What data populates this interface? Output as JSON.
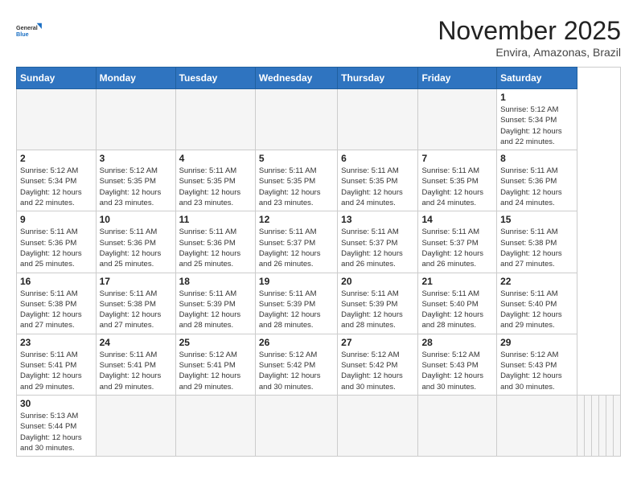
{
  "header": {
    "logo_general": "General",
    "logo_blue": "Blue",
    "month_title": "November 2025",
    "location": "Envira, Amazonas, Brazil"
  },
  "weekdays": [
    "Sunday",
    "Monday",
    "Tuesday",
    "Wednesday",
    "Thursday",
    "Friday",
    "Saturday"
  ],
  "days": [
    {
      "date": "",
      "info": ""
    },
    {
      "date": "",
      "info": ""
    },
    {
      "date": "",
      "info": ""
    },
    {
      "date": "",
      "info": ""
    },
    {
      "date": "",
      "info": ""
    },
    {
      "date": "",
      "info": ""
    },
    {
      "date": "1",
      "info": "Sunrise: 5:12 AM\nSunset: 5:34 PM\nDaylight: 12 hours\nand 22 minutes."
    },
    {
      "date": "2",
      "info": "Sunrise: 5:12 AM\nSunset: 5:34 PM\nDaylight: 12 hours\nand 22 minutes."
    },
    {
      "date": "3",
      "info": "Sunrise: 5:12 AM\nSunset: 5:35 PM\nDaylight: 12 hours\nand 23 minutes."
    },
    {
      "date": "4",
      "info": "Sunrise: 5:11 AM\nSunset: 5:35 PM\nDaylight: 12 hours\nand 23 minutes."
    },
    {
      "date": "5",
      "info": "Sunrise: 5:11 AM\nSunset: 5:35 PM\nDaylight: 12 hours\nand 23 minutes."
    },
    {
      "date": "6",
      "info": "Sunrise: 5:11 AM\nSunset: 5:35 PM\nDaylight: 12 hours\nand 24 minutes."
    },
    {
      "date": "7",
      "info": "Sunrise: 5:11 AM\nSunset: 5:35 PM\nDaylight: 12 hours\nand 24 minutes."
    },
    {
      "date": "8",
      "info": "Sunrise: 5:11 AM\nSunset: 5:36 PM\nDaylight: 12 hours\nand 24 minutes."
    },
    {
      "date": "9",
      "info": "Sunrise: 5:11 AM\nSunset: 5:36 PM\nDaylight: 12 hours\nand 25 minutes."
    },
    {
      "date": "10",
      "info": "Sunrise: 5:11 AM\nSunset: 5:36 PM\nDaylight: 12 hours\nand 25 minutes."
    },
    {
      "date": "11",
      "info": "Sunrise: 5:11 AM\nSunset: 5:36 PM\nDaylight: 12 hours\nand 25 minutes."
    },
    {
      "date": "12",
      "info": "Sunrise: 5:11 AM\nSunset: 5:37 PM\nDaylight: 12 hours\nand 26 minutes."
    },
    {
      "date": "13",
      "info": "Sunrise: 5:11 AM\nSunset: 5:37 PM\nDaylight: 12 hours\nand 26 minutes."
    },
    {
      "date": "14",
      "info": "Sunrise: 5:11 AM\nSunset: 5:37 PM\nDaylight: 12 hours\nand 26 minutes."
    },
    {
      "date": "15",
      "info": "Sunrise: 5:11 AM\nSunset: 5:38 PM\nDaylight: 12 hours\nand 27 minutes."
    },
    {
      "date": "16",
      "info": "Sunrise: 5:11 AM\nSunset: 5:38 PM\nDaylight: 12 hours\nand 27 minutes."
    },
    {
      "date": "17",
      "info": "Sunrise: 5:11 AM\nSunset: 5:38 PM\nDaylight: 12 hours\nand 27 minutes."
    },
    {
      "date": "18",
      "info": "Sunrise: 5:11 AM\nSunset: 5:39 PM\nDaylight: 12 hours\nand 28 minutes."
    },
    {
      "date": "19",
      "info": "Sunrise: 5:11 AM\nSunset: 5:39 PM\nDaylight: 12 hours\nand 28 minutes."
    },
    {
      "date": "20",
      "info": "Sunrise: 5:11 AM\nSunset: 5:39 PM\nDaylight: 12 hours\nand 28 minutes."
    },
    {
      "date": "21",
      "info": "Sunrise: 5:11 AM\nSunset: 5:40 PM\nDaylight: 12 hours\nand 28 minutes."
    },
    {
      "date": "22",
      "info": "Sunrise: 5:11 AM\nSunset: 5:40 PM\nDaylight: 12 hours\nand 29 minutes."
    },
    {
      "date": "23",
      "info": "Sunrise: 5:11 AM\nSunset: 5:41 PM\nDaylight: 12 hours\nand 29 minutes."
    },
    {
      "date": "24",
      "info": "Sunrise: 5:11 AM\nSunset: 5:41 PM\nDaylight: 12 hours\nand 29 minutes."
    },
    {
      "date": "25",
      "info": "Sunrise: 5:12 AM\nSunset: 5:41 PM\nDaylight: 12 hours\nand 29 minutes."
    },
    {
      "date": "26",
      "info": "Sunrise: 5:12 AM\nSunset: 5:42 PM\nDaylight: 12 hours\nand 30 minutes."
    },
    {
      "date": "27",
      "info": "Sunrise: 5:12 AM\nSunset: 5:42 PM\nDaylight: 12 hours\nand 30 minutes."
    },
    {
      "date": "28",
      "info": "Sunrise: 5:12 AM\nSunset: 5:43 PM\nDaylight: 12 hours\nand 30 minutes."
    },
    {
      "date": "29",
      "info": "Sunrise: 5:12 AM\nSunset: 5:43 PM\nDaylight: 12 hours\nand 30 minutes."
    },
    {
      "date": "30",
      "info": "Sunrise: 5:13 AM\nSunset: 5:44 PM\nDaylight: 12 hours\nand 30 minutes."
    }
  ]
}
